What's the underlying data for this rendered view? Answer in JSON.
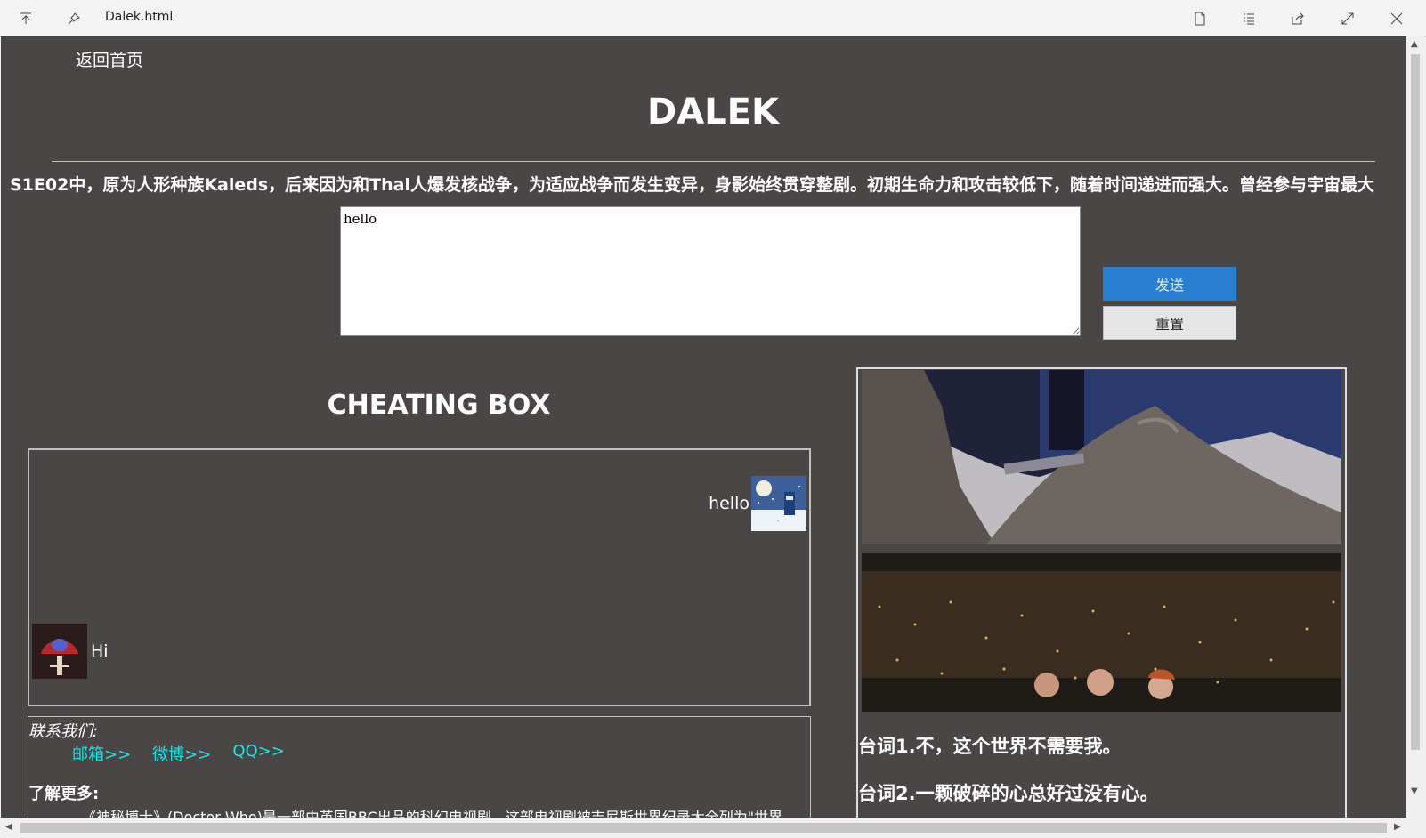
{
  "window": {
    "title": "Dalek.html"
  },
  "titlebar_icons": [
    "scroll-to-top-icon",
    "pin-icon",
    "reading-view-icon",
    "list-icon",
    "share-icon",
    "expand-icon",
    "close-icon"
  ],
  "page": {
    "home_link": "返回首页",
    "heading": "DALEK",
    "marquee": "S1E02中，原为人形种族Kaleds，后来因为和Thal人爆发核战争，为适应战争而发生变异，身影始终贯穿整剧。初期生命力和攻击较低下，随着时间递进而强大。曾经参与宇宙最大"
  },
  "form": {
    "message_value": "hello",
    "send_label": "发送",
    "reset_label": "重置"
  },
  "chat": {
    "title": "CHEATING BOX",
    "messages": [
      {
        "side": "right",
        "text": "hello",
        "avatar": "tardis-snow-avatar"
      },
      {
        "side": "left",
        "text": "Hi",
        "avatar": "dalek-avatar"
      }
    ]
  },
  "contact": {
    "label": "联系我们:",
    "links": [
      "邮箱>>",
      "微博>>",
      "QQ>>"
    ],
    "more_label": "了解更多:",
    "more_text": "《神秘博士》(Doctor Who)是一部由英国BBC出品的科幻电视剧，这部电视剧被吉尼斯世界纪录大全列为\"世界"
  },
  "gallery": {
    "quotes": [
      "台词1.不，这个世界不需要我。",
      "台词2.一颗破碎的心总好过没有心。"
    ]
  },
  "colors": {
    "page_bg": "#494645",
    "link": "#21e3e3",
    "send_button": "#2a7ed2"
  }
}
